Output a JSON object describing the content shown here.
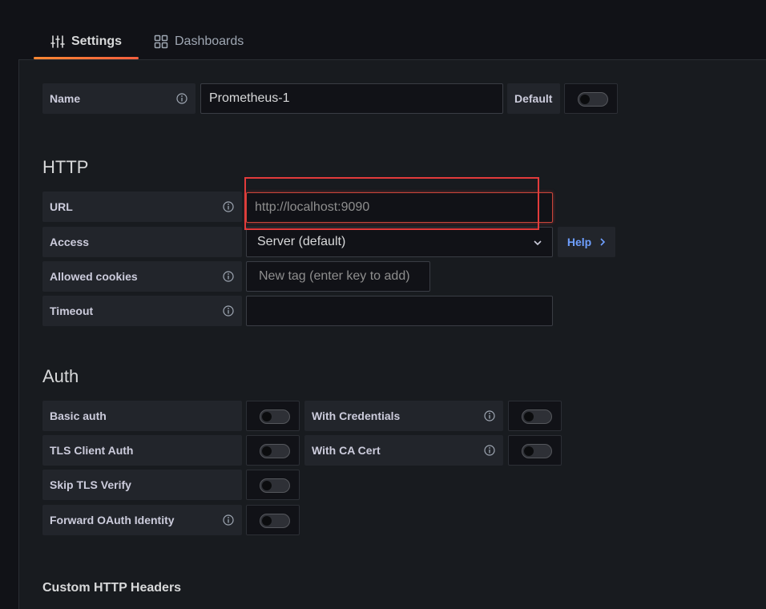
{
  "tabs": [
    {
      "label": "Settings",
      "icon": "sliders-icon",
      "active": true
    },
    {
      "label": "Dashboards",
      "icon": "grid-icon",
      "active": false
    }
  ],
  "name_row": {
    "label": "Name",
    "value": "Prometheus-1",
    "default_label": "Default",
    "default_on": false
  },
  "http": {
    "title": "HTTP",
    "url_label": "URL",
    "url_placeholder": "http://localhost:9090",
    "access_label": "Access",
    "access_value": "Server (default)",
    "help_label": "Help",
    "cookies_label": "Allowed cookies",
    "cookies_placeholder": "New tag (enter key to add)",
    "timeout_label": "Timeout",
    "timeout_value": ""
  },
  "auth": {
    "title": "Auth",
    "basic_auth": "Basic auth",
    "with_credentials": "With Credentials",
    "tls_client_auth": "TLS Client Auth",
    "with_ca_cert": "With CA Cert",
    "skip_tls_verify": "Skip TLS Verify",
    "forward_oauth": "Forward OAuth Identity"
  },
  "custom_headers": {
    "title": "Custom HTTP Headers"
  },
  "colors": {
    "accent_tab": "#ff8833",
    "help_link": "#6e9fff",
    "highlight": "#e23b3b"
  }
}
